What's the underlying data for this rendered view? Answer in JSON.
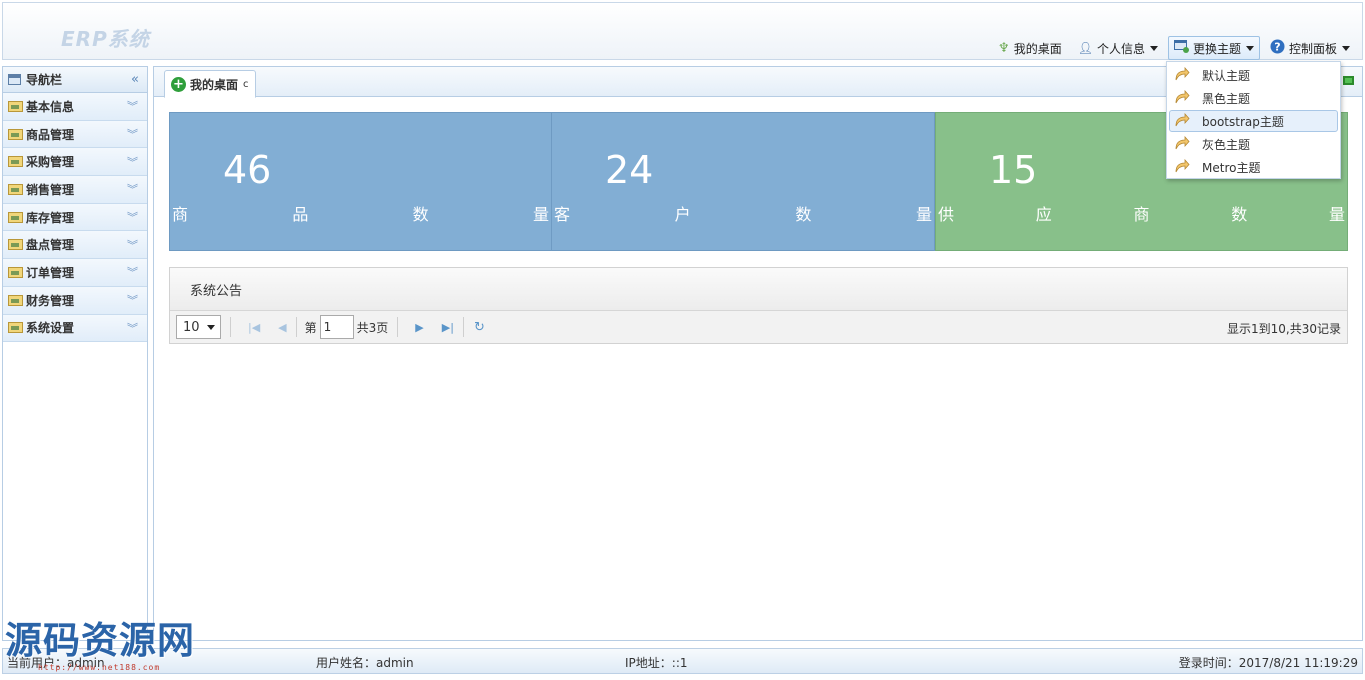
{
  "header": {
    "logo": "ERP系统",
    "nav": {
      "desktop": "我的桌面",
      "profile": "个人信息",
      "theme": "更换主题",
      "control": "控制面板"
    }
  },
  "theme_menu": {
    "items": [
      "默认主题",
      "黑色主题",
      "bootstrap主题",
      "灰色主题",
      "Metro主题"
    ],
    "selected": "bootstrap主题"
  },
  "sidebar": {
    "title": "导航栏",
    "items": [
      "基本信息",
      "商品管理",
      "采购管理",
      "销售管理",
      "库存管理",
      "盘点管理",
      "订单管理",
      "财务管理",
      "系统设置"
    ]
  },
  "tab": {
    "title": "我的桌面"
  },
  "stats": [
    {
      "value": "46",
      "label": [
        "商",
        "品",
        "数",
        "量"
      ],
      "color": "#82aed4"
    },
    {
      "value": "24",
      "label": [
        "客",
        "户",
        "数",
        "量"
      ],
      "color": "#82aed4"
    },
    {
      "value": "15",
      "label": [
        "供",
        "应",
        "商",
        "数",
        "量"
      ],
      "color": "#88c08a"
    }
  ],
  "notice": {
    "title": "系统公告",
    "pager": {
      "page_size": "10",
      "page_prefix": "第",
      "page_value": "1",
      "total": "共3页",
      "info": "显示1到10,共30记录"
    }
  },
  "footer": {
    "current_user": "当前用户：admin",
    "user_name": "用户姓名：admin",
    "ip": "IP地址：::1",
    "login_time": "登录时间：2017/8/21 11:19:29"
  },
  "watermark": {
    "text": "源码资源网",
    "url": "http://www.net188.com"
  }
}
